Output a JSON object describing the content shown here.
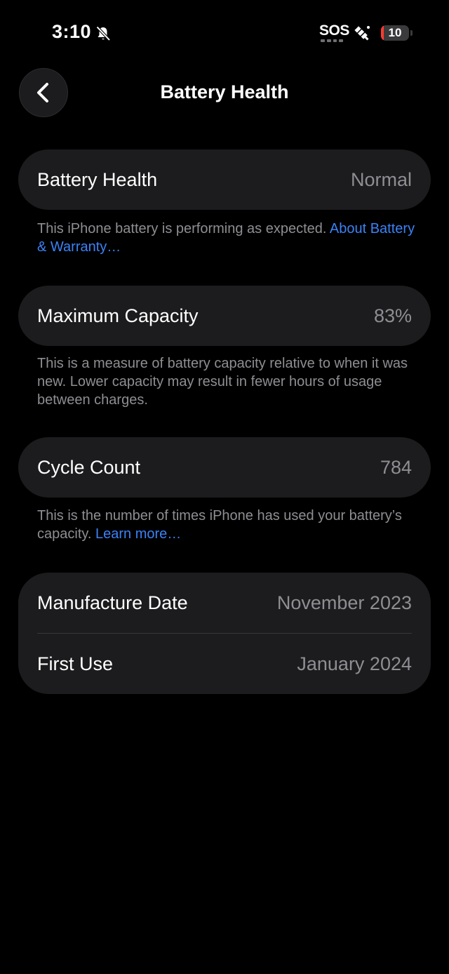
{
  "status_bar": {
    "time": "3:10",
    "sos": "SOS",
    "battery_level": "10",
    "battery_fraction": 0.1,
    "battery_color": "#ff3b30",
    "icons": [
      "bell-slash-icon",
      "satellite-icon",
      "battery-icon"
    ]
  },
  "nav": {
    "title": "Battery Health",
    "back_icon": "chevron-left-icon"
  },
  "battery_health": {
    "label": "Battery Health",
    "value": "Normal",
    "note": "This iPhone battery is performing as expected. ",
    "note_link": "About Battery & Warranty…"
  },
  "max_capacity": {
    "label": "Maximum Capacity",
    "value": "83%",
    "note": "This is a measure of battery capacity relative to when it was new. Lower capacity may result in fewer hours of usage between charges."
  },
  "cycle_count": {
    "label": "Cycle Count",
    "value": "784",
    "note": "This is the number of times iPhone has used your battery’s capacity. ",
    "note_link": "Learn more…"
  },
  "dates": {
    "manufacture_label": "Manufacture Date",
    "manufacture_value": "November 2023",
    "first_use_label": "First Use",
    "first_use_value": "January 2024"
  },
  "colors": {
    "background": "#000000",
    "card": "#1c1c1e",
    "secondary_text": "#8e8e93",
    "link": "#3b82f6"
  }
}
